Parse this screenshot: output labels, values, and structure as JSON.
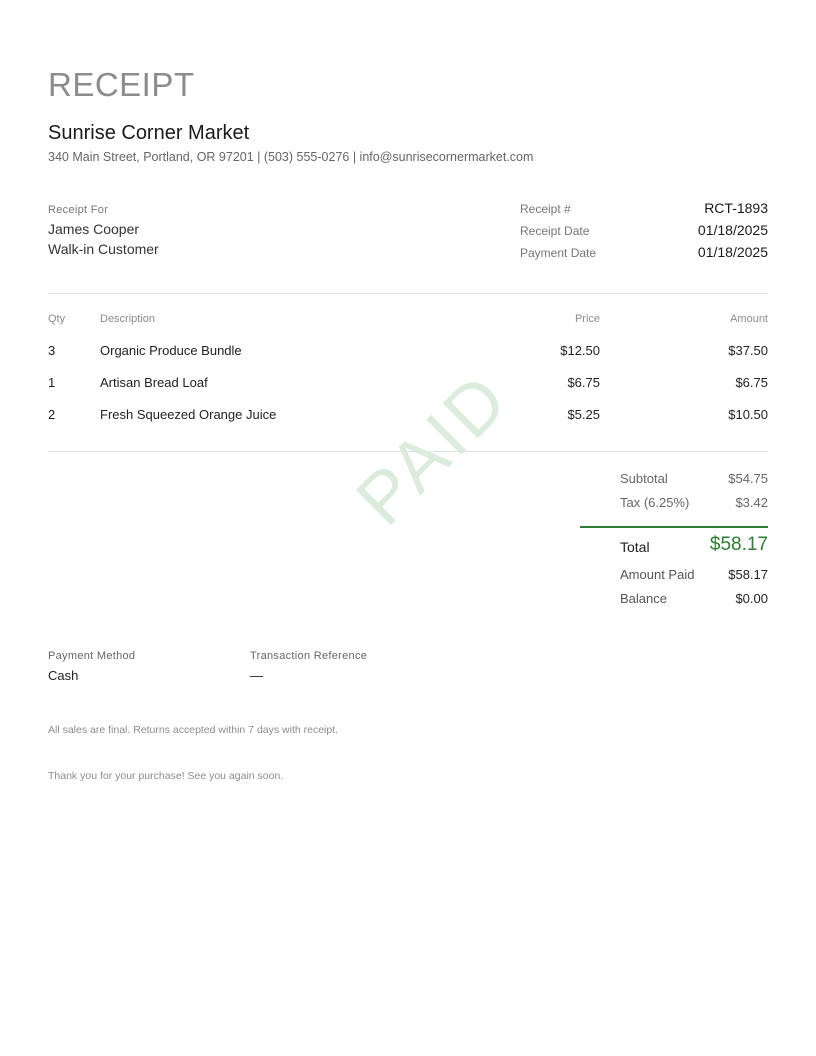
{
  "document": {
    "title": "RECEIPT",
    "watermark": "PAID"
  },
  "company": {
    "name": "Sunrise Corner Market",
    "contact": "340 Main Street, Portland, OR 97201 | (503) 555-0276 | info@sunrisecornermarket.com"
  },
  "bill_to": {
    "label": "Receipt For",
    "name": "James Cooper",
    "type": "Walk-in Customer"
  },
  "meta": [
    {
      "label": "Receipt #",
      "value": "RCT-1893"
    },
    {
      "label": "Receipt Date",
      "value": "01/18/2025"
    },
    {
      "label": "Payment Date",
      "value": "01/18/2025"
    }
  ],
  "items_header": {
    "qty": "Qty",
    "description": "Description",
    "price": "Price",
    "amount": "Amount"
  },
  "items": [
    {
      "qty": "3",
      "description": "Organic Produce Bundle",
      "price": "$12.50",
      "amount": "$37.50"
    },
    {
      "qty": "1",
      "description": "Artisan Bread Loaf",
      "price": "$6.75",
      "amount": "$6.75"
    },
    {
      "qty": "2",
      "description": "Fresh Squeezed Orange Juice",
      "price": "$5.25",
      "amount": "$10.50"
    }
  ],
  "totals": {
    "subtotal_label": "Subtotal",
    "subtotal_value": "$54.75",
    "tax_label": "Tax (6.25%)",
    "tax_value": "$3.42",
    "total_label": "Total",
    "total_value": "$58.17",
    "amount_paid_label": "Amount Paid",
    "amount_paid_value": "$58.17",
    "balance_label": "Balance",
    "balance_value": "$0.00"
  },
  "payment": {
    "method_label": "Payment Method",
    "method_value": "Cash",
    "reference_label": "Transaction Reference",
    "reference_value": "—"
  },
  "footer": {
    "note": "All sales are final. Returns accepted within 7 days with receipt.",
    "thanks": "Thank you for your purchase! See you again soon."
  },
  "colors": {
    "accent": "#2e7d32",
    "watermark": "#cfe6d2",
    "muted_text": "#8c8c8c"
  }
}
